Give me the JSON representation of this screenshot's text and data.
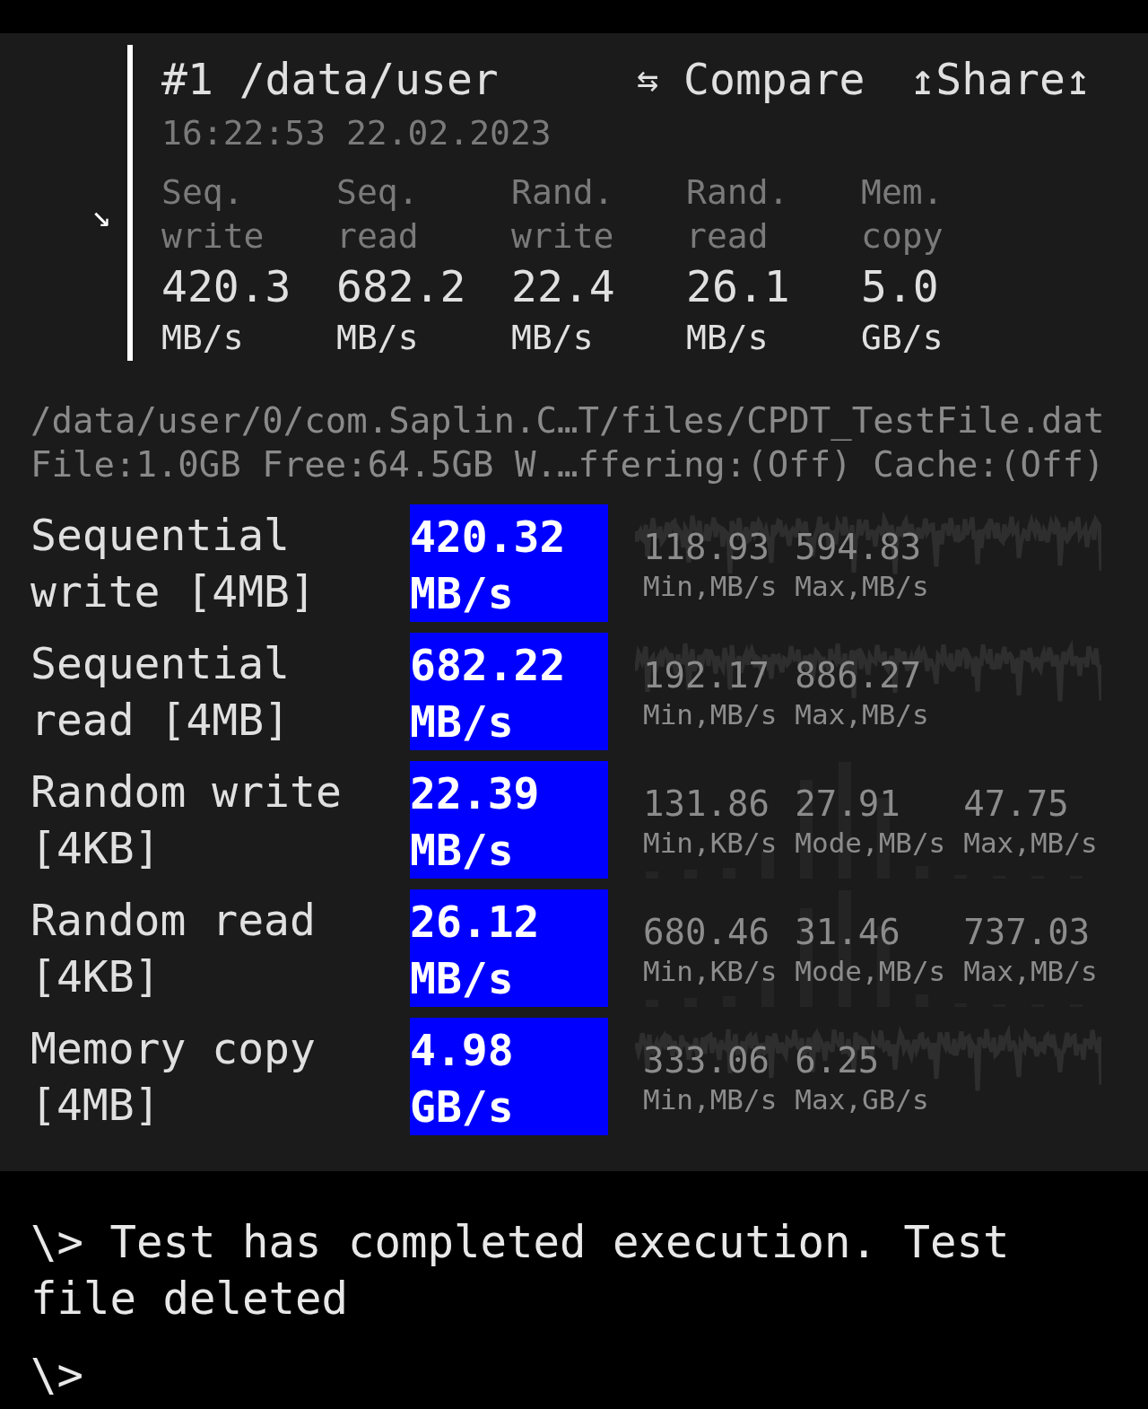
{
  "result": {
    "arrow": "↘",
    "title": "#1 /data/user",
    "compare": {
      "icon": "⇆",
      "label": "Compare"
    },
    "share": "↥Share↥",
    "timestamp": "16:22:53 22.02.2023",
    "summary": [
      {
        "label": "Seq. write",
        "value": "420.3",
        "unit": "MB/s"
      },
      {
        "label": "Seq. read",
        "value": "682.2",
        "unit": "MB/s"
      },
      {
        "label": "Rand. write",
        "value": "22.4",
        "unit": "MB/s"
      },
      {
        "label": "Rand. read",
        "value": "26.1",
        "unit": "MB/s"
      },
      {
        "label": "Mem. copy",
        "value": "5.0",
        "unit": "GB/s"
      }
    ]
  },
  "file_path": "/data/user/0/com.Saplin.C…T/files/CPDT_TestFile.dat",
  "file_info": "File:1.0GB Free:64.5GB W.…ffering:(Off) Cache:(Off)",
  "tests": [
    {
      "label": "Sequential write [4MB]",
      "value": "420.32",
      "unit": "MB/s",
      "kind": "line",
      "stats": [
        {
          "value": "118.93",
          "label": "Min,MB/s"
        },
        {
          "value": "594.83",
          "label": "Max,MB/s"
        }
      ]
    },
    {
      "label": "Sequential read [4MB]",
      "value": "682.22",
      "unit": "MB/s",
      "kind": "line",
      "stats": [
        {
          "value": "192.17",
          "label": "Min,MB/s"
        },
        {
          "value": "886.27",
          "label": "Max,MB/s"
        }
      ]
    },
    {
      "label": "Random write [4KB]",
      "value": "22.39",
      "unit": "MB/s",
      "kind": "bars",
      "stats": [
        {
          "value": "131.86",
          "label": "Min,KB/s"
        },
        {
          "value": "27.91",
          "label": "Mode,MB/s"
        },
        {
          "value": "47.75",
          "label": "Max,MB/s"
        }
      ]
    },
    {
      "label": "Random read [4KB]",
      "value": "26.12",
      "unit": "MB/s",
      "kind": "bars",
      "stats": [
        {
          "value": "680.46",
          "label": "Min,KB/s"
        },
        {
          "value": "31.46",
          "label": "Mode,MB/s"
        },
        {
          "value": "737.03",
          "label": "Max,MB/s"
        }
      ]
    },
    {
      "label": "Memory copy [4MB]",
      "value": "4.98",
      "unit": "GB/s",
      "kind": "line",
      "stats": [
        {
          "value": "333.06",
          "label": "Min,MB/s"
        },
        {
          "value": "6.25",
          "label": "Max,GB/s"
        }
      ]
    }
  ],
  "terminal": [
    "\\> Test has completed execution. Test file deleted",
    "\\>"
  ]
}
